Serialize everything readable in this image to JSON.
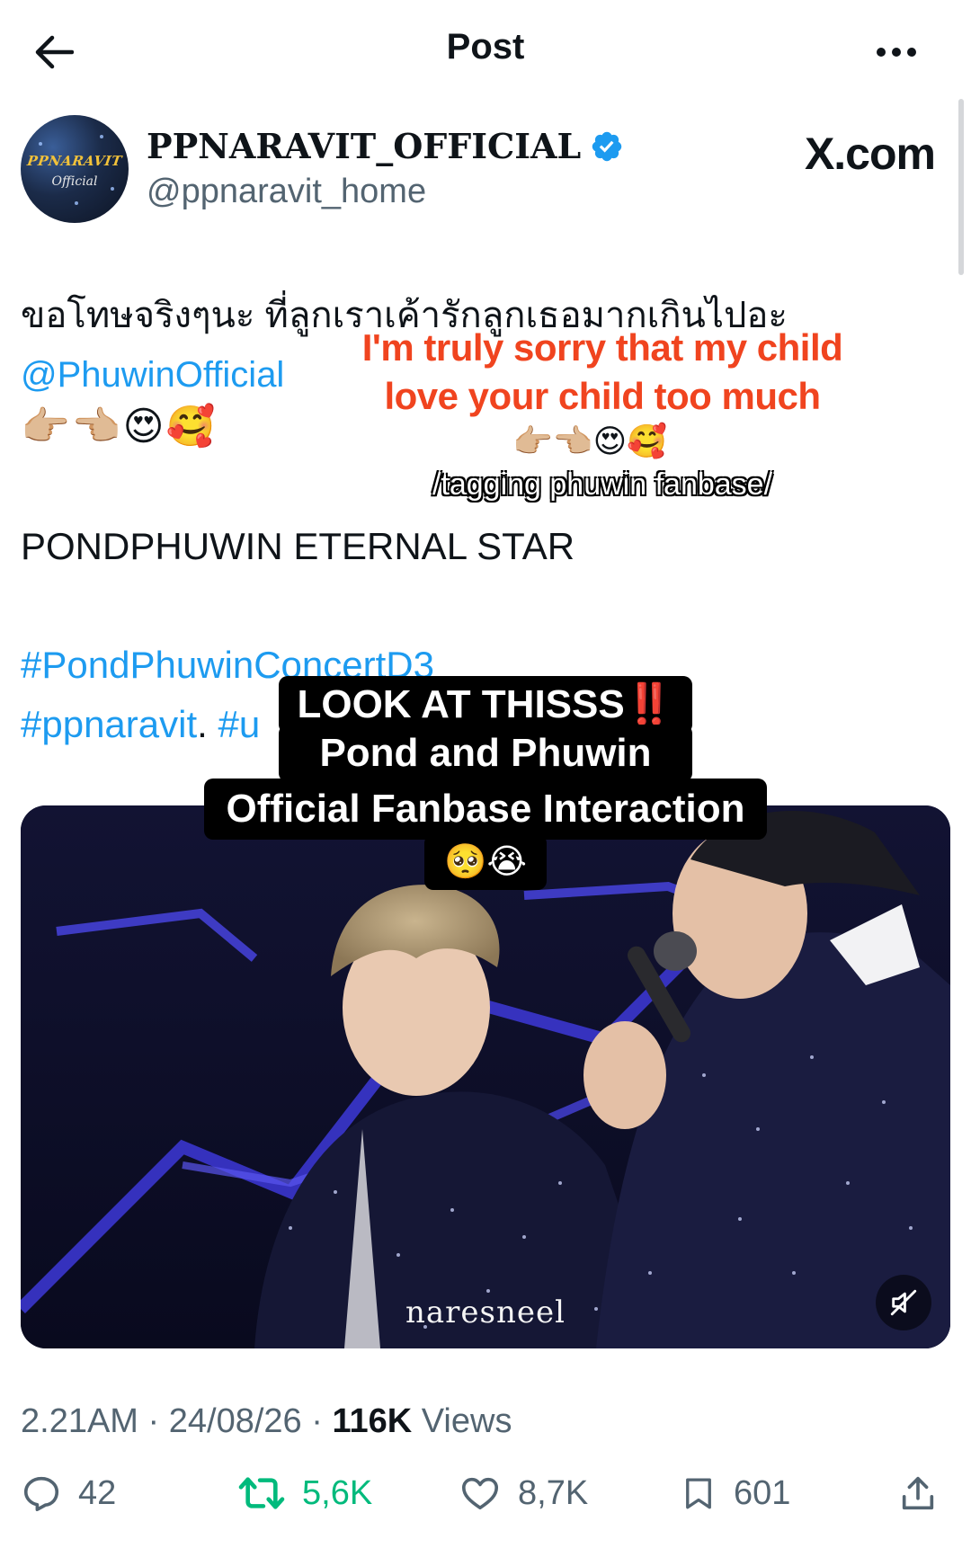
{
  "header": {
    "title": "Post"
  },
  "author": {
    "display_name": "PPNARAVIT_OFFICIAL",
    "handle": "@ppnaravit_home",
    "avatar_text": "PPNARAVIT",
    "avatar_subtext": "Official",
    "verified_color": "#1d9bf0"
  },
  "brand": {
    "label": "X.com"
  },
  "tweet": {
    "thai_line": "ขอโทษจริงๆนะ ที่ลูกเราเค้ารักลูกเธอมากเกินไปอะ",
    "mention": "@PhuwinOfficial",
    "emojis": "👉🏼👈🏼😍🥰",
    "line_eternal": "PONDPHUWIN ETERNAL STAR",
    "hashtag_1": "#PondPhuwinConcertD3",
    "hashtag_2": "#ppnaravit",
    "hashtag_2_sep": ".",
    "hashtag_3_partial": "#u"
  },
  "overlay": {
    "translation_line1": "I'm truly sorry that my child",
    "translation_line2": "love your child too much",
    "translation_emojis": "👉🏼👈🏼😍🥰",
    "tag_note": "/tagging phuwin fanbase/",
    "caption_line1": "LOOK AT THISSS‼️",
    "caption_line2": "Pond and Phuwin",
    "caption_line3": "Official Fanbase Interaction",
    "caption_line4": "🥺😭"
  },
  "media": {
    "watermark": "naresneel",
    "mute_icon": "speaker-muted-icon"
  },
  "meta": {
    "time": "2.21AM",
    "date": "24/08/26",
    "views_count": "116K",
    "views_label": "Views"
  },
  "actions": {
    "replies": "42",
    "retweets": "5,6K",
    "likes": "8,7K",
    "bookmarks": "601"
  },
  "colors": {
    "link": "#1d9bf0",
    "retweet_green": "#00ba7c",
    "overlay_orange": "#f0441f",
    "secondary_text": "#536471"
  }
}
